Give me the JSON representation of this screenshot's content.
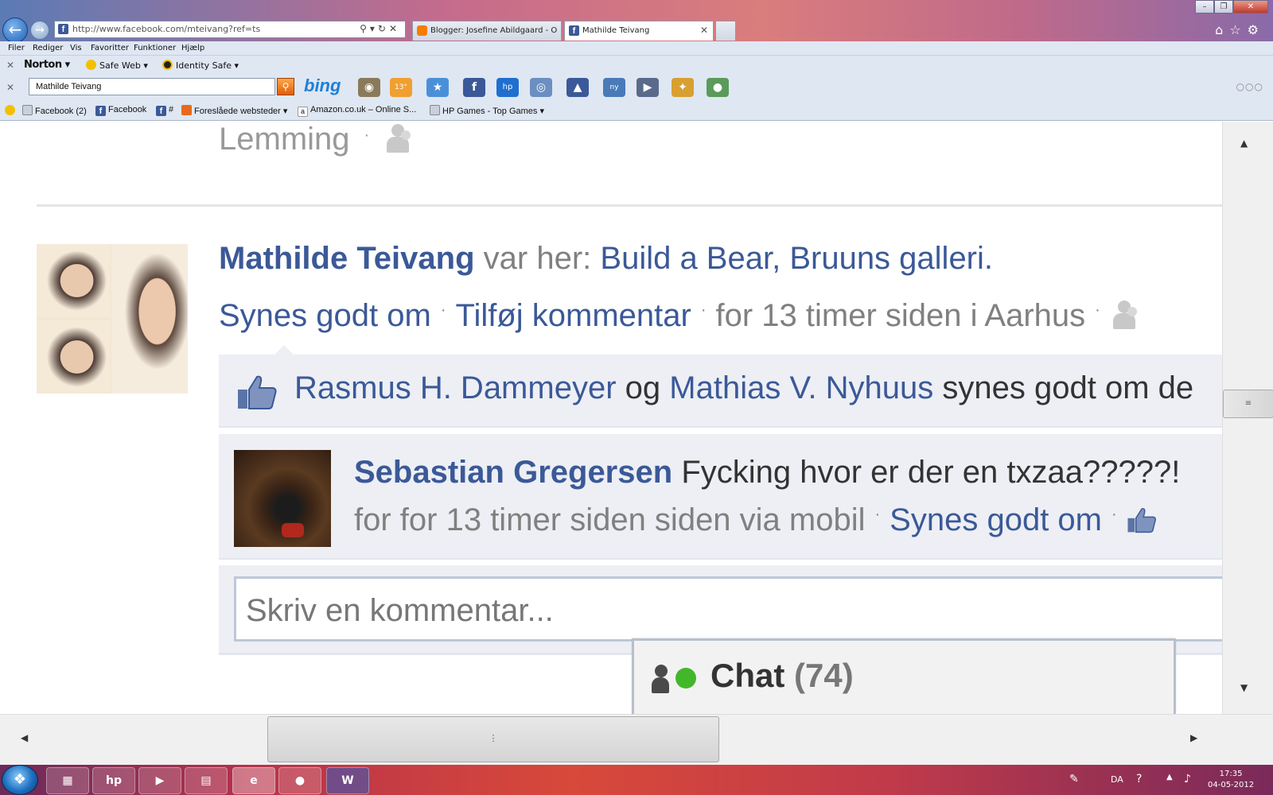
{
  "browser": {
    "address_url": "http://www.facebook.com/mteivang?ref=ts",
    "tabs": [
      {
        "label": "Blogger: Josefine Abildgaard - Opret i..."
      },
      {
        "label": "Mathilde Teivang"
      }
    ],
    "menu": [
      "Filer",
      "Rediger",
      "Vis",
      "Favoritter",
      "Funktioner",
      "Hjælp"
    ],
    "norton": {
      "logo": "Norton",
      "safe_web": "Safe Web",
      "identity_safe": "Identity Safe"
    },
    "search": {
      "value": "Mathilde Teivang",
      "bing_logo": "bing",
      "weather_temp": "13°",
      "ny_badge": "ny"
    },
    "favorites": [
      {
        "label": "Facebook (2)",
        "icon": "page-icon"
      },
      {
        "label": "Facebook",
        "icon": "facebook-icon"
      },
      {
        "label": "#",
        "icon": "facebook-icon"
      },
      {
        "label": "Foreslåede websteder",
        "icon": "suggested-sites-icon"
      },
      {
        "label": "Amazon.co.uk – Online S...",
        "icon": "amazon-icon"
      },
      {
        "label": "HP Games - Top Games",
        "icon": "page-icon"
      }
    ]
  },
  "feed": {
    "prev_post_tail": "Lemming",
    "post": {
      "author": "Mathilde Teivang",
      "verb": "var her:",
      "places": "Build a Bear, Bruuns galleri.",
      "actions": {
        "like": "Synes godt om",
        "comment": "Tilføj kommentar",
        "time": "for 13 timer siden i Aarhus"
      },
      "likes": {
        "person1": "Rasmus H. Dammeyer",
        "and": "og",
        "person2": "Mathias V. Nyhuus",
        "tail": "synes godt om de"
      },
      "comment": {
        "author": "Sebastian Gregersen",
        "text": "Fycking hvor er der en txzaa?????!",
        "time": "for for 13 timer siden siden via mobil",
        "like": "Synes godt om"
      },
      "write_placeholder": "Skriv en kommentar..."
    }
  },
  "chat": {
    "label": "Chat",
    "count": "(74)"
  },
  "taskbar": {
    "lang": "DA",
    "time": "17:35",
    "date": "04-05-2012"
  },
  "colors": {
    "facebook_blue": "#3b5998",
    "online_green": "#42b72a",
    "gray_text": "#808080"
  }
}
